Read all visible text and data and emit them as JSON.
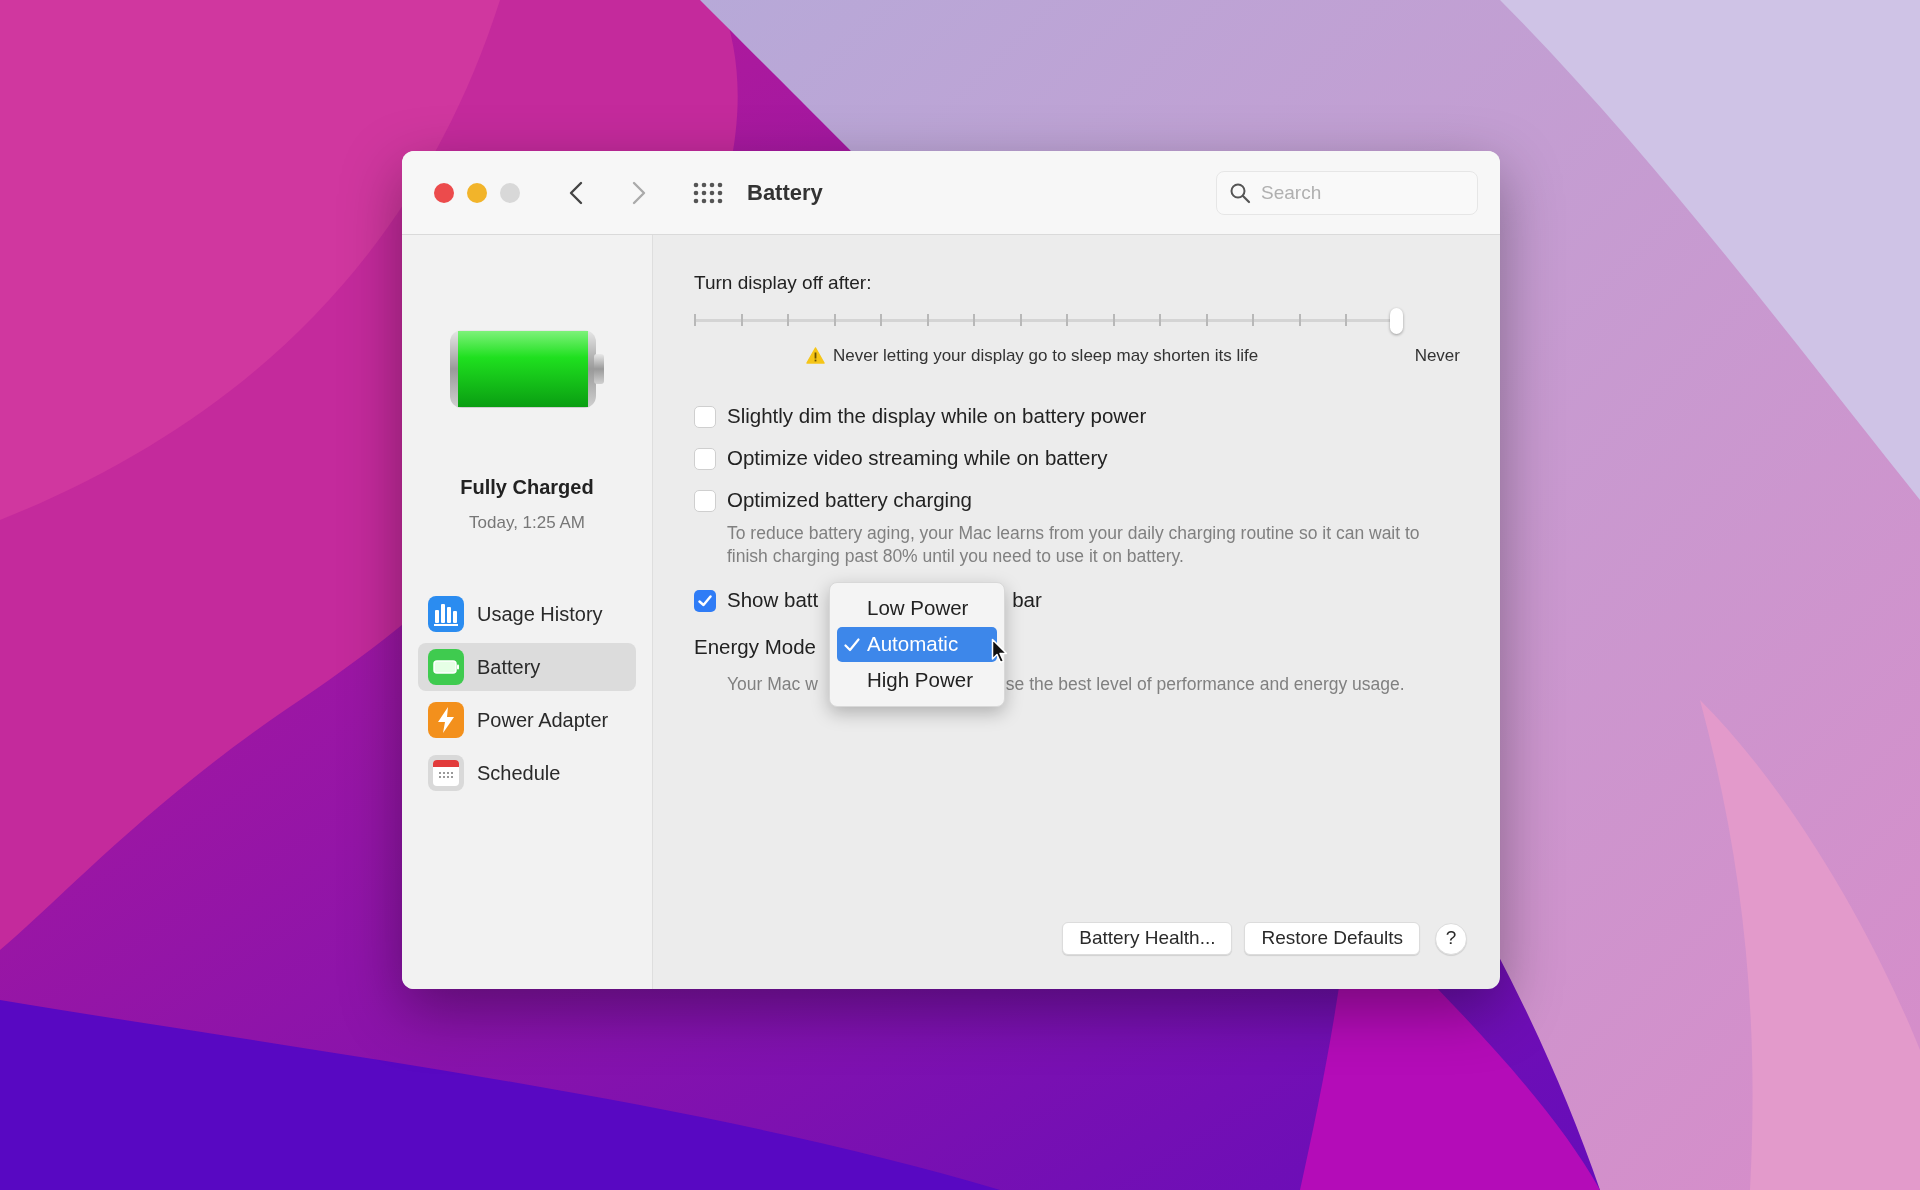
{
  "window": {
    "title": "Battery",
    "search": {
      "placeholder": "Search"
    }
  },
  "sidebar": {
    "status": "Fully Charged",
    "status_time": "Today, 1:25 AM",
    "items": [
      {
        "label": "Usage History",
        "kind": "chart",
        "selected": false
      },
      {
        "label": "Battery",
        "kind": "battery",
        "selected": true
      },
      {
        "label": "Power Adapter",
        "kind": "bolt",
        "selected": false
      },
      {
        "label": "Schedule",
        "kind": "calendar",
        "selected": false
      }
    ]
  },
  "display_sleep": {
    "label": "Turn display off after:",
    "level": 1,
    "warning": "Never letting your display go to sleep may shorten its life",
    "end_label": "Never"
  },
  "options": [
    {
      "label": "Slightly dim the display while on battery power",
      "checked": false
    },
    {
      "label": "Optimize video streaming while on battery",
      "checked": false
    },
    {
      "label": "Optimized battery charging",
      "checked": false,
      "description": "To reduce battery aging, your Mac learns from your daily charging routine so it can wait to finish charging past 80% until you need to use it on battery."
    },
    {
      "label": "Show batt",
      "label_after": "bar",
      "checked": true
    }
  ],
  "energy_mode": {
    "label": "Energy Mode",
    "description_before": "Your Mac w",
    "description_after": "se the best level of performance and energy usage.",
    "menu": [
      {
        "label": "Low Power",
        "selected": false
      },
      {
        "label": "Automatic",
        "selected": true
      },
      {
        "label": "High Power",
        "selected": false
      }
    ]
  },
  "buttons": [
    "Battery Health...",
    "Restore Defaults"
  ],
  "help": "?"
}
